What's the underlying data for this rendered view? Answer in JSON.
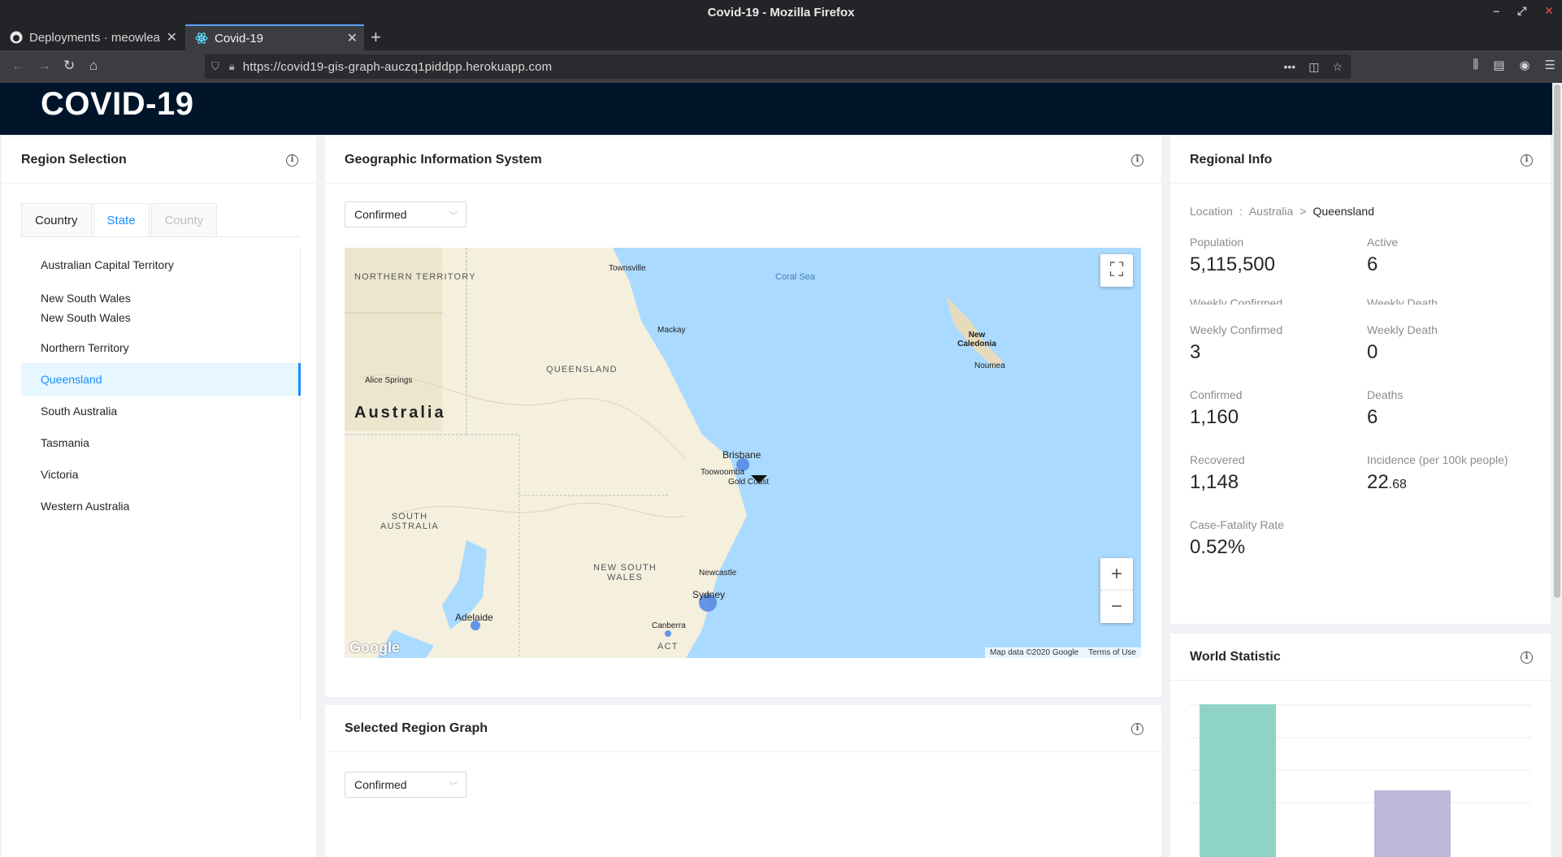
{
  "browser": {
    "window_title": "Covid-19 - Mozilla Firefox",
    "tabs": [
      {
        "label": "Deployments · meowlea",
        "icon": "github-icon"
      },
      {
        "label": "Covid-19",
        "icon": "react-icon"
      }
    ],
    "url": "https://covid19-gis-graph-auczq1piddpp.herokuapp.com"
  },
  "app": {
    "title": "COVID-19",
    "colors": {
      "header_bg": "#01152a",
      "accent": "#1890ff",
      "bar_green": "#8fd3c6",
      "bar_purple": "#bdb8da"
    }
  },
  "region_selection": {
    "title": "Region Selection",
    "tabs": [
      {
        "label": "Country",
        "state": "normal"
      },
      {
        "label": "State",
        "state": "selected"
      },
      {
        "label": "County",
        "state": "disabled"
      }
    ],
    "items": [
      "Australian Capital Territory",
      "New South Wales",
      "New South Wales",
      "Northern Territory",
      "Queensland",
      "South Australia",
      "Tasmania",
      "Victoria",
      "Western Australia"
    ],
    "selected": "Queensland"
  },
  "gis": {
    "title": "Geographic Information System",
    "metric_select": "Confirmed",
    "map": {
      "labels": {
        "northern_territory": "NORTHERN TERRITORY",
        "queensland": "QUEENSLAND",
        "south_australia": "SOUTH AUSTRALIA",
        "new_south_wales": "NEW SOUTH WALES",
        "act": "ACT",
        "australia": "Australia",
        "coral_sea": "Coral Sea",
        "new_caledonia": "New Caledonia",
        "townsville": "Townsville",
        "mackay": "Mackay",
        "alice_springs": "Alice Springs",
        "brisbane": "Brisbane",
        "toowoomba": "Toowoomba",
        "gold_coast": "Gold Coast",
        "noumea": "Noumea",
        "newcastle": "Newcastle",
        "sydney": "Sydney",
        "canberra": "Canberra",
        "adelaide": "Adelaide"
      },
      "google": "Google",
      "attribution": "Map data ©2020 Google",
      "terms": "Terms of Use",
      "zoom_in": "+",
      "zoom_out": "−"
    }
  },
  "graph": {
    "title": "Selected Region Graph",
    "metric_select": "Confirmed"
  },
  "regional_info": {
    "title": "Regional Info",
    "location_label": "Location",
    "separator": ":",
    "crumb_sep": ">",
    "country": "Australia",
    "region": "Queensland",
    "ghost_labels": [
      "Weekly Confirmed",
      "Weekly Death"
    ],
    "stats": {
      "population": {
        "label": "Population",
        "value": "5,115,500"
      },
      "active": {
        "label": "Active",
        "value": "6"
      },
      "weekly_confirmed": {
        "label": "Weekly Confirmed",
        "value": "3"
      },
      "weekly_death": {
        "label": "Weekly Death",
        "value": "0"
      },
      "confirmed": {
        "label": "Confirmed",
        "value": "1,160"
      },
      "deaths": {
        "label": "Deaths",
        "value": "6"
      },
      "recovered": {
        "label": "Recovered",
        "value": "1,148"
      },
      "incidence": {
        "label": "Incidence (per 100k people)",
        "value_int": "22",
        "value_dec": ".68"
      },
      "cfr": {
        "label": "Case-Fatality Rate",
        "value": "0.52%"
      }
    }
  },
  "world_statistic": {
    "title": "World Statistic"
  },
  "chart_data": {
    "type": "bar",
    "categories": [
      "",
      ""
    ],
    "values": [
      100,
      47
    ],
    "title": "World Statistic",
    "xlabel": "",
    "ylabel": "",
    "grid": true,
    "colors": [
      "#8fd3c6",
      "#bdb8da"
    ]
  }
}
